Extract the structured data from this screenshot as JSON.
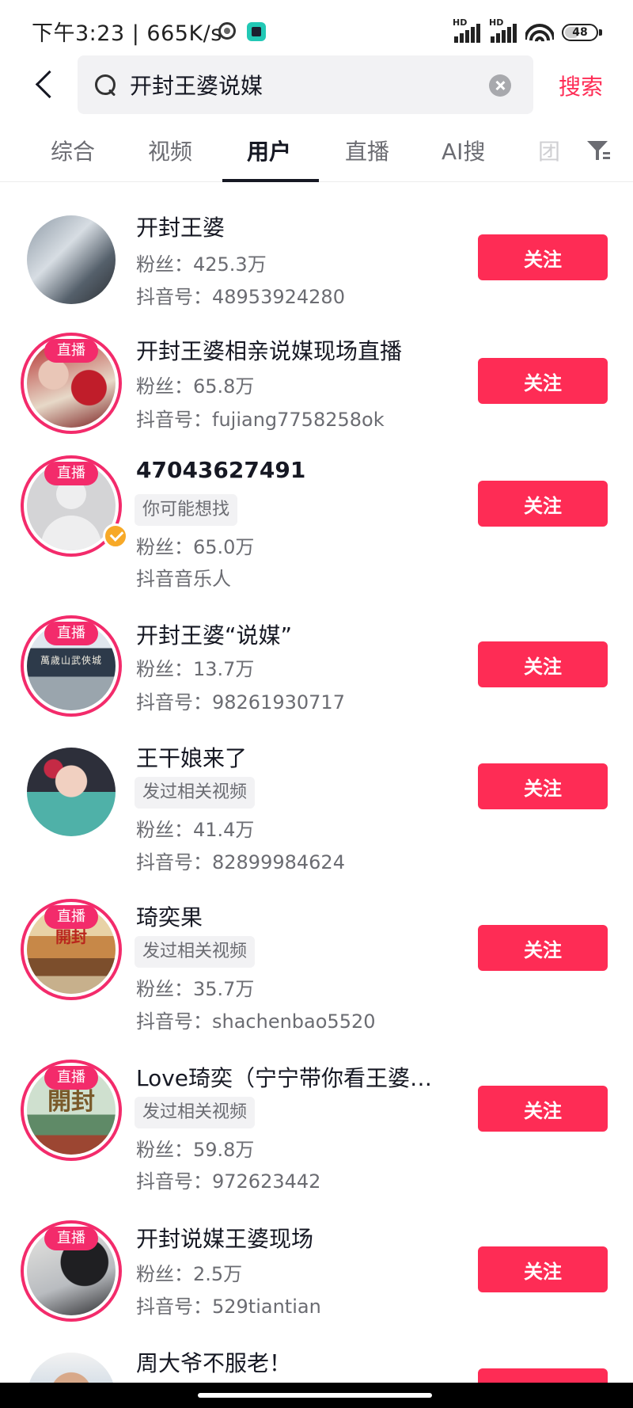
{
  "status_bar": {
    "time": "下午3:23",
    "network_speed": "665K/s",
    "network_label_1": "HD",
    "network_label_2": "HD",
    "battery": "48",
    "battery_percent": 48
  },
  "search": {
    "query": "开封王婆说媒",
    "submit_label": "搜索"
  },
  "tabs": [
    {
      "label": "综合"
    },
    {
      "label": "视频"
    },
    {
      "label": "用户",
      "active": true
    },
    {
      "label": "直播"
    },
    {
      "label": "AI搜"
    },
    {
      "label": "团"
    }
  ],
  "follow_label": "关注",
  "users": [
    {
      "name": "开封王婆",
      "fans": "粉丝：425.3万",
      "account": "抖音号：48953924280"
    },
    {
      "name": "开封王婆相亲说媒现场直播",
      "live": "直播",
      "fans": "粉丝：65.8万",
      "account": "抖音号：fujiang7758258ok"
    },
    {
      "name": "47043627491",
      "live": "直播",
      "tag": "你可能想找",
      "fans": "粉丝：65.0万",
      "account": "抖音音乐人"
    },
    {
      "name": "开封王婆“说媒”",
      "live": "直播",
      "avatar_text": "萬歲山武俠城",
      "fans": "粉丝：13.7万",
      "account": "抖音号：98261930717"
    },
    {
      "name": "王干娘来了",
      "tag": "发过相关视频",
      "fans": "粉丝：41.4万",
      "account": "抖音号：82899984624"
    },
    {
      "name": "琦奕果",
      "live": "直播",
      "avatar_text": "開封",
      "tag": "发过相关视频",
      "fans": "粉丝：35.7万",
      "account": "抖音号：shachenbao5520"
    },
    {
      "name": "Love琦奕（宁宁带你看王婆…",
      "live": "直播",
      "avatar_text": "開封",
      "tag": "发过相关视频",
      "fans": "粉丝：59.8万",
      "account": "抖音号：972623442"
    },
    {
      "name": "开封说媒王婆现场",
      "live": "直播",
      "fans": "粉丝：2.5万",
      "account": "抖音号：529tiantian"
    },
    {
      "name": "周大爷不服老！"
    }
  ],
  "colors": {
    "accent": "#fe2c55",
    "live_ring": "#f32b6b",
    "verified": "#f7a928"
  }
}
